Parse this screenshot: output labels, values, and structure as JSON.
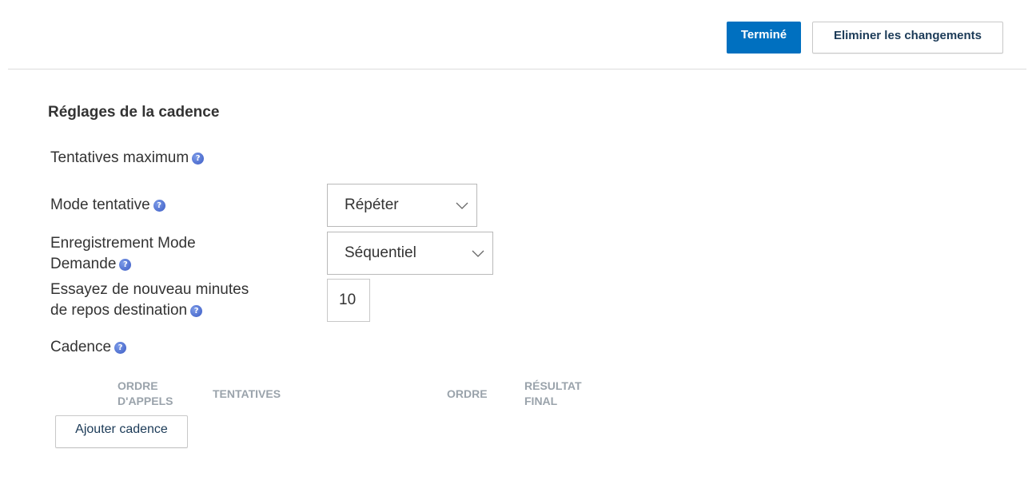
{
  "toolbar": {
    "done_label": "Terminé",
    "discard_label": "Eliminer les changements"
  },
  "settings": {
    "title": "Réglages de la cadence",
    "max_attempts_label": "Tentatives maximum",
    "attempt_mode_label": "Mode tentative",
    "attempt_mode_value": "Répéter",
    "record_mode_label_line1": "Enregistrement Mode",
    "record_mode_label_line2": "Demande",
    "record_mode_value": "Séquentiel",
    "retry_label_line1": "Essayez de nouveau minutes",
    "retry_label_line2": "de repos destination",
    "retry_value": "10",
    "cadence_label": "Cadence"
  },
  "cadence_table": {
    "columns": [
      {
        "line1": "ORDRE",
        "line2": "D'APPELS"
      },
      {
        "line1": "TENTATIVES",
        "line2": ""
      },
      {
        "line1": "ORDRE",
        "line2": ""
      },
      {
        "line1": "RÉSULTAT",
        "line2": "FINAL"
      }
    ],
    "add_label": "Ajouter cadence"
  },
  "icons": {
    "help": "help-icon",
    "dropdown": "chevron-down-icon"
  },
  "colors": {
    "primary": "#0070c0",
    "help_icon": "#4a6ad0",
    "column_header": "#9aa3ab"
  }
}
